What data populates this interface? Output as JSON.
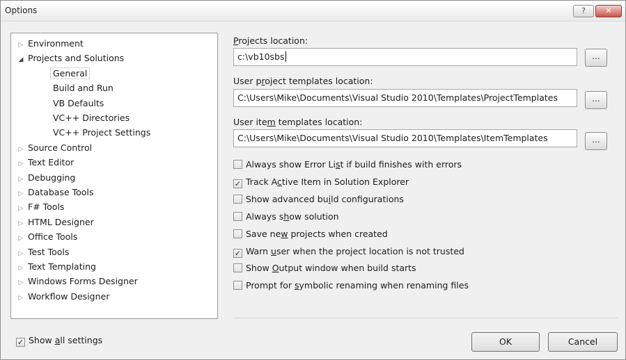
{
  "window": {
    "title": "Options",
    "help_glyph": "?",
    "close_glyph": "✕"
  },
  "tree": {
    "items": [
      {
        "label": "Environment",
        "level": 0,
        "expanded": false
      },
      {
        "label": "Projects and Solutions",
        "level": 0,
        "expanded": true
      },
      {
        "label": "General",
        "level": 1,
        "selected": true
      },
      {
        "label": "Build and Run",
        "level": 1
      },
      {
        "label": "VB Defaults",
        "level": 1
      },
      {
        "label": "VC++ Directories",
        "level": 1
      },
      {
        "label": "VC++ Project Settings",
        "level": 1
      },
      {
        "label": "Source Control",
        "level": 0,
        "expanded": false
      },
      {
        "label": "Text Editor",
        "level": 0,
        "expanded": false
      },
      {
        "label": "Debugging",
        "level": 0,
        "expanded": false
      },
      {
        "label": "Database Tools",
        "level": 0,
        "expanded": false
      },
      {
        "label": "F# Tools",
        "level": 0,
        "expanded": false
      },
      {
        "label": "HTML Designer",
        "level": 0,
        "expanded": false
      },
      {
        "label": "Office Tools",
        "level": 0,
        "expanded": false
      },
      {
        "label": "Test Tools",
        "level": 0,
        "expanded": false
      },
      {
        "label": "Text Templating",
        "level": 0,
        "expanded": false
      },
      {
        "label": "Windows Forms Designer",
        "level": 0,
        "expanded": false
      },
      {
        "label": "Workflow Designer",
        "level": 0,
        "expanded": false
      }
    ]
  },
  "fields": {
    "projects_location": {
      "label_pre": "",
      "label_key": "P",
      "label_post": "rojects location:",
      "value": "c:\\vb10sbs"
    },
    "project_templates": {
      "label_pre": "User p",
      "label_key": "r",
      "label_post": "oject templates location:",
      "value": "C:\\Users\\Mike\\Documents\\Visual Studio 2010\\Templates\\ProjectTemplates"
    },
    "item_templates": {
      "label_pre": "User ite",
      "label_key": "m",
      "label_post": " templates location:",
      "value": "C:\\Users\\Mike\\Documents\\Visual Studio 2010\\Templates\\ItemTemplates"
    },
    "browse_label": "..."
  },
  "checkboxes": [
    {
      "pre": "Always show Error Li",
      "key": "s",
      "post": "t if build finishes with errors",
      "checked": false
    },
    {
      "pre": "Track A",
      "key": "c",
      "post": "tive Item in Solution Explorer",
      "checked": true
    },
    {
      "pre": "Show advanced bu",
      "key": "i",
      "post": "ld configurations",
      "checked": false
    },
    {
      "pre": "Always s",
      "key": "h",
      "post": "ow solution",
      "checked": false
    },
    {
      "pre": "Save ne",
      "key": "w",
      "post": " projects when created",
      "checked": false
    },
    {
      "pre": "Warn ",
      "key": "u",
      "post": "ser when the project location is not trusted",
      "checked": true
    },
    {
      "pre": "Show ",
      "key": "O",
      "post": "utput window when build starts",
      "checked": false
    },
    {
      "pre": "Prompt for ",
      "key": "s",
      "post": "ymbolic renaming when renaming files",
      "checked": false
    }
  ],
  "footer": {
    "show_all": {
      "pre": "Show ",
      "key": "a",
      "post": "ll settings",
      "checked": true
    },
    "ok_label": "OK",
    "cancel_label": "Cancel"
  },
  "check_glyph": "✓",
  "arrow_collapsed": "▷",
  "arrow_expanded": "◢"
}
